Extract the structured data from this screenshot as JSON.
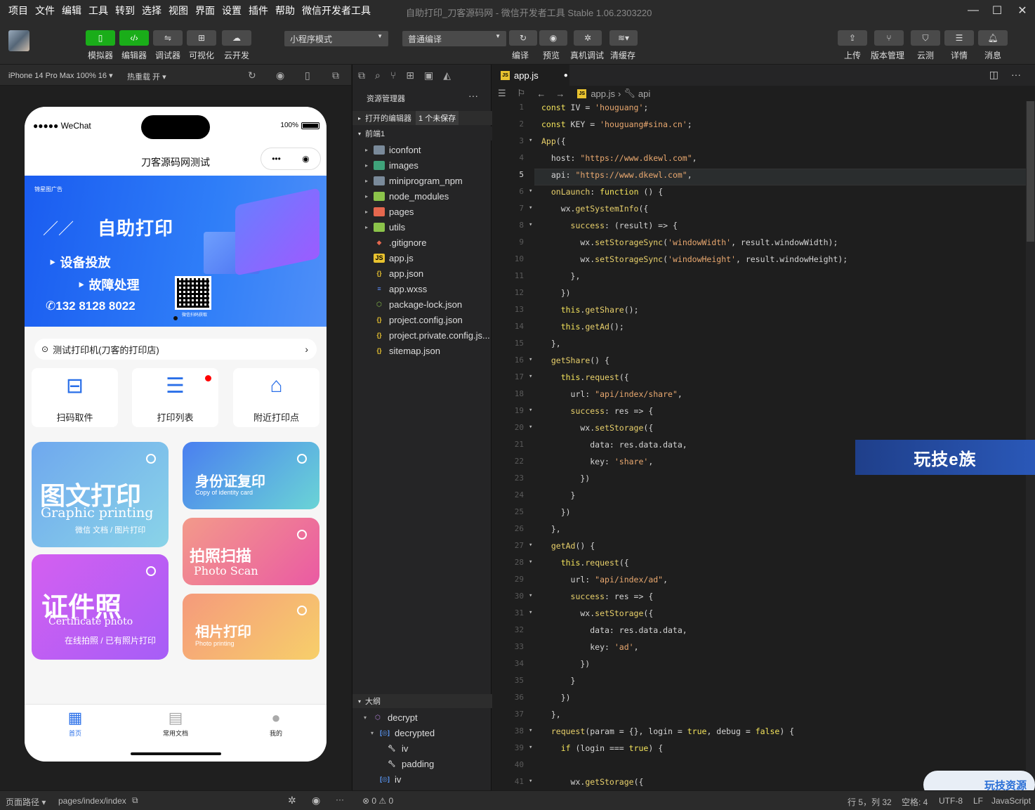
{
  "menu": [
    "项目",
    "文件",
    "编辑",
    "工具",
    "转到",
    "选择",
    "视图",
    "界面",
    "设置",
    "插件",
    "帮助",
    "微信开发者工具"
  ],
  "window_title": "自助打印_刀客源码网 - 微信开发者工具 Stable 1.06.2303220",
  "toolbar": {
    "left_buttons": [
      "模拟器",
      "编辑器",
      "调试器",
      "可视化",
      "云开发"
    ],
    "mode_select": "小程序模式",
    "compile_select": "普通编译",
    "mid_buttons": [
      "编译",
      "预览",
      "真机调试",
      "清缓存"
    ],
    "right_buttons": [
      "上传",
      "版本管理",
      "云测",
      "详情",
      "消息"
    ]
  },
  "simulator": {
    "device": "iPhone 14 Pro Max 100% 16",
    "hot_reload": "热重载 开",
    "status": {
      "carrier": "●●●●● WeChat",
      "battery": "100%"
    },
    "nav_title": "刀客源码网测试",
    "banner": {
      "tag": "锦星图广告",
      "title": "自助打印",
      "line1": "设备投放",
      "line2": "故障处理",
      "phone": "132 8128 8022",
      "qr_caption": "微信扫码获取"
    },
    "shop": "测试打印机(刀客的打印店)",
    "quick": [
      "扫码取件",
      "打印列表",
      "附近打印点"
    ],
    "cards": [
      {
        "cn": "图文打印",
        "en": "Graphic printing",
        "sub": "微信 文档 / 图片打印"
      },
      {
        "cn": "身份证复印",
        "en": "Copy of identity card",
        "sub": ""
      },
      {
        "cn": "拍照扫描",
        "en": "Photo Scan",
        "sub": ""
      },
      {
        "cn": "证件照",
        "en": "Certificate photo",
        "sub": "在线拍照 / 已有照片打印"
      },
      {
        "cn": "相片打印",
        "en": "Photo printing",
        "sub": ""
      }
    ],
    "tabs": [
      "首页",
      "常用文档",
      "我的"
    ]
  },
  "explorer": {
    "title": "资源管理器",
    "open_editors": "打开的编辑器",
    "unsaved": "1 个未保存",
    "project": "前端1",
    "files": [
      {
        "name": "iconfont",
        "kind": "folder"
      },
      {
        "name": "images",
        "kind": "folder"
      },
      {
        "name": "miniprogram_npm",
        "kind": "folder"
      },
      {
        "name": "node_modules",
        "kind": "folder"
      },
      {
        "name": "pages",
        "kind": "folder"
      },
      {
        "name": "utils",
        "kind": "folder"
      },
      {
        "name": ".gitignore",
        "kind": "file"
      },
      {
        "name": "app.js",
        "kind": "file"
      },
      {
        "name": "app.json",
        "kind": "file"
      },
      {
        "name": "app.wxss",
        "kind": "file"
      },
      {
        "name": "package-lock.json",
        "kind": "file"
      },
      {
        "name": "project.config.json",
        "kind": "file"
      },
      {
        "name": "project.private.config.js...",
        "kind": "file"
      },
      {
        "name": "sitemap.json",
        "kind": "file"
      }
    ],
    "outline_title": "大纲",
    "outline": [
      "decrypt",
      "decrypted",
      "iv",
      "padding",
      "iv"
    ]
  },
  "editor": {
    "tab": "app.js",
    "crumb_file": "app.js",
    "crumb_sym": "api",
    "current_line": 5
  },
  "code_lines": [
    "const IV = 'houguang';",
    "const KEY = 'houguang#sina.cn';",
    "App({",
    "  host: \"https://www.dkewl.com\",",
    "  api: \"https://www.dkewl.com\",",
    "  onLaunch: function () {",
    "    wx.getSystemInfo({",
    "      success: (result) => {",
    "        wx.setStorageSync('windowWidth', result.windowWidth);",
    "        wx.setStorageSync('windowHeight', result.windowHeight);",
    "      },",
    "    })",
    "    this.getShare();",
    "    this.getAd();",
    "  },",
    "  getShare() {",
    "    this.request({",
    "      url: \"api/index/share\",",
    "      success: res => {",
    "        wx.setStorage({",
    "          data: res.data.data,",
    "          key: 'share',",
    "        })",
    "      }",
    "    })",
    "  },",
    "  getAd() {",
    "    this.request({",
    "      url: \"api/index/ad\",",
    "      success: res => {",
    "        wx.setStorage({",
    "          data: res.data.data,",
    "          key: 'ad',",
    "        })",
    "      }",
    "    })",
    "  },",
    "  request(param = {}, login = true, debug = false) {",
    "    if (login === true) {",
    "",
    "      wx.getStorage({"
  ],
  "status_bar": {
    "page_path_label": "页面路径",
    "page_path": "pages/index/index",
    "problems": "⊗ 0 ⚠ 0",
    "cursor": "行 5，列 32",
    "spaces": "空格: 4",
    "encoding": "UTF-8",
    "eol": "LF",
    "lang": "JavaScript"
  },
  "watermarks": {
    "w1": "玩技e族",
    "w2": "玩技资源"
  }
}
